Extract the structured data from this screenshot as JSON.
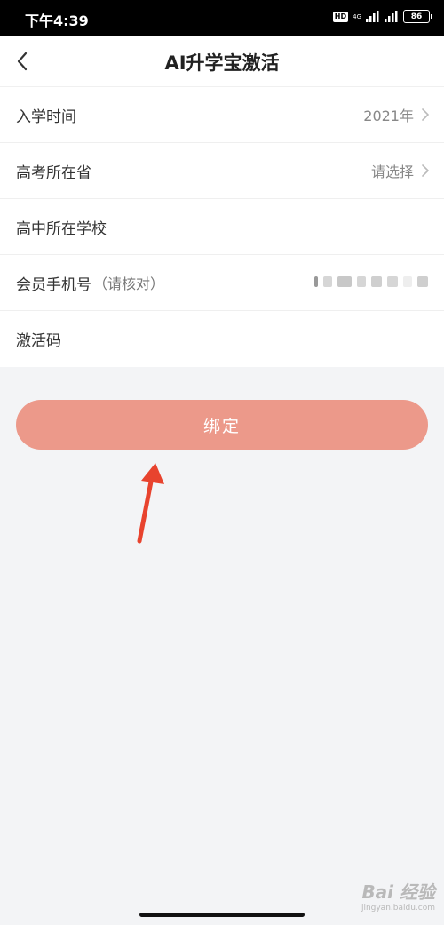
{
  "status_bar": {
    "time": "下午4:39",
    "hd": "HD",
    "network": "4G",
    "battery": "86"
  },
  "header": {
    "title": "AI升学宝激活",
    "back_icon": "chevron-left-icon"
  },
  "form": {
    "rows": [
      {
        "label": "入学时间",
        "value": "2021年",
        "has_chevron": true
      },
      {
        "label": "高考所在省",
        "value": "请选择",
        "has_chevron": true
      },
      {
        "label": "高中所在学校",
        "value": "",
        "has_chevron": false
      },
      {
        "label": "会员手机号",
        "hint": "（请核对）",
        "value_blurred": true
      },
      {
        "label": "激活码",
        "value": "",
        "has_chevron": false
      }
    ]
  },
  "bind_button": {
    "label": "绑定",
    "color": "#ec998a"
  },
  "annotation": {
    "arrow_color": "#e8432e",
    "arrow_icon": "red-arrow-icon"
  },
  "watermark": {
    "line1": "Bai 经验",
    "line2": "jingyan.baidu.com"
  }
}
